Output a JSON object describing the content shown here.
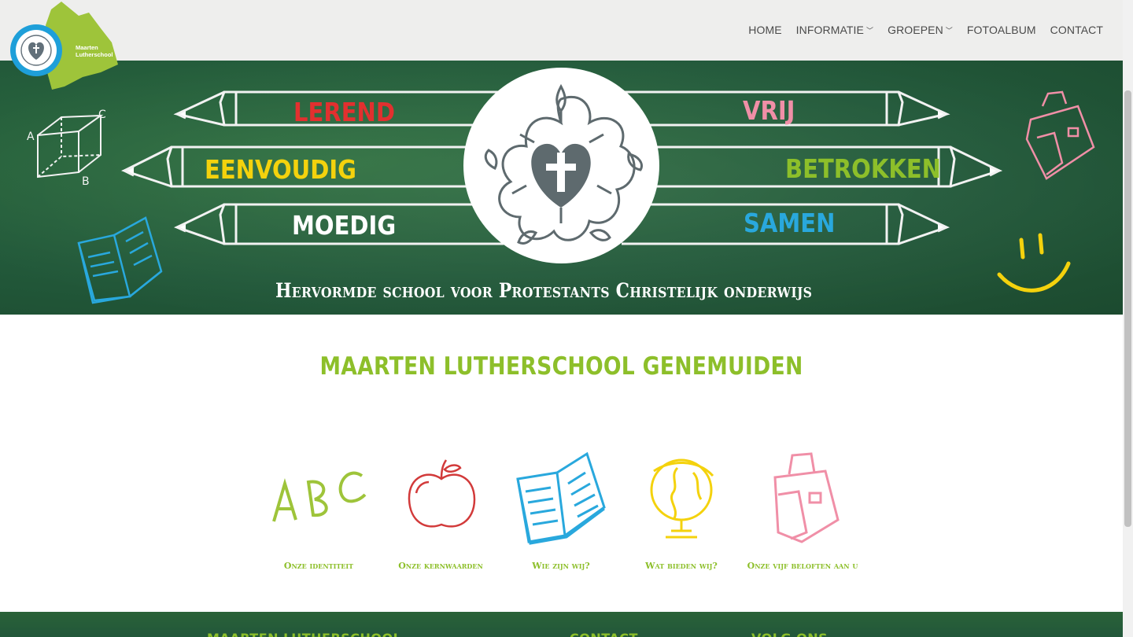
{
  "logo": {
    "line1": "Maarten",
    "line2": "Lutherschool"
  },
  "nav": [
    {
      "label": "HOME",
      "dropdown": false
    },
    {
      "label": "INFORMATIE",
      "dropdown": true
    },
    {
      "label": "GROEPEN",
      "dropdown": true
    },
    {
      "label": "FOTOALBUM",
      "dropdown": false
    },
    {
      "label": "CONTACT",
      "dropdown": false
    }
  ],
  "hero": {
    "words_left": [
      "LEREND",
      "EENVOUDIG",
      "MOEDIG"
    ],
    "words_right": [
      "VRIJ",
      "BETROKKEN",
      "SAMEN"
    ],
    "tagline": "Hervormde school voor Protestants Christelijk onderwijs",
    "colors": {
      "lerend": "#e2302f",
      "eenvoudig": "#f4d20d",
      "moedig": "#ffffff",
      "vrij": "#f08fa7",
      "betrokken": "#8dbf2a",
      "samen": "#29a8dd"
    }
  },
  "main": {
    "title": "MAARTEN LUTHERSCHOOL GENEMUIDEN"
  },
  "tiles": [
    {
      "label": "Onze identiteit",
      "icon": "abc-icon"
    },
    {
      "label": "Onze kernwaarden",
      "icon": "apple-icon"
    },
    {
      "label": "Wie zijn wij?",
      "icon": "book-icon"
    },
    {
      "label": "Wat bieden wij?",
      "icon": "globe-icon"
    },
    {
      "label": "Onze vijf beloften aan u",
      "icon": "schoolbag-icon"
    }
  ],
  "footer": {
    "col1": "MAARTEN LUTHERSCHOOL",
    "col2": "CONTACT",
    "col3": "VOLG ONS"
  },
  "accent": "#8dbf2a",
  "chalkboard": "#22593a"
}
